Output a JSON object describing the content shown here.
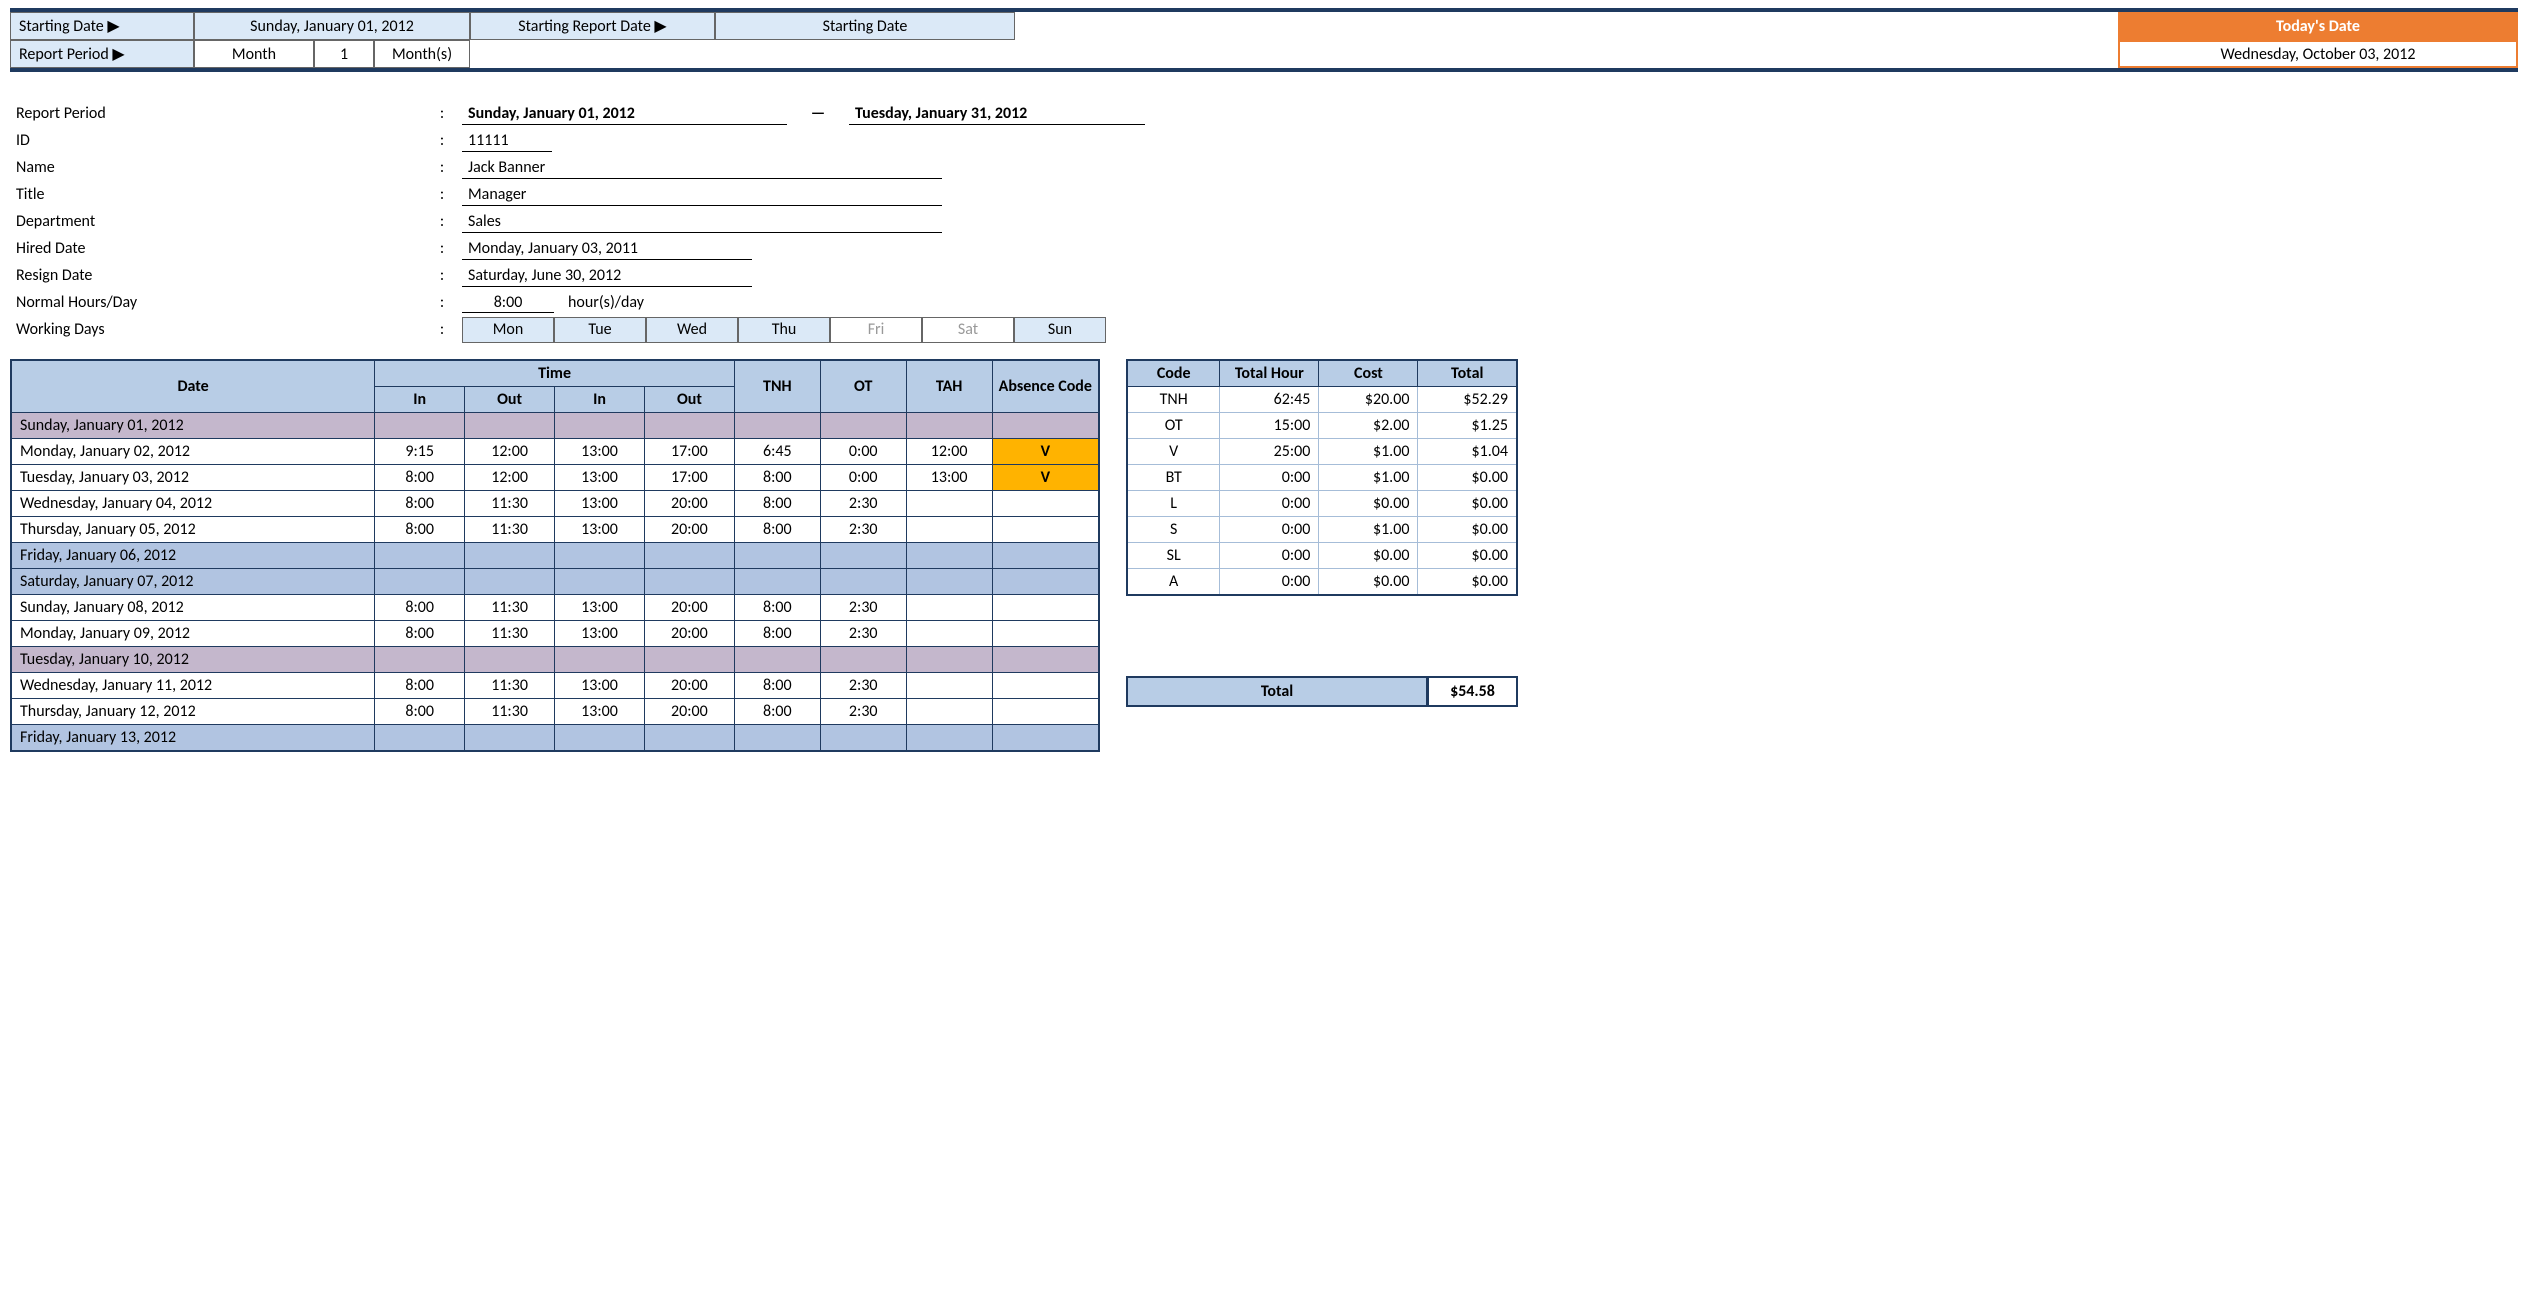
{
  "topbar": {
    "starting_date_label": "Starting Date ▶",
    "starting_date_value": "Sunday, January 01, 2012",
    "report_period_label": "Report Period ▶",
    "report_period_type": "Month",
    "report_period_num": "1",
    "report_period_unit": "Month(s)",
    "starting_report_date_label": "Starting Report Date ▶",
    "starting_report_date_value": "Starting Date",
    "todays_date_label": "Today's Date",
    "todays_date_value": "Wednesday, October 03, 2012"
  },
  "info": {
    "report_period_label": "Report Period",
    "period_from": "Sunday, January 01, 2012",
    "period_to": "Tuesday, January 31, 2012",
    "id_label": "ID",
    "id": "11111",
    "name_label": "Name",
    "name": "Jack Banner",
    "title_label": "Title",
    "title": "Manager",
    "dept_label": "Department",
    "dept": "Sales",
    "hired_label": "Hired Date",
    "hired": "Monday, January 03, 2011",
    "resign_label": "Resign Date",
    "resign": "Saturday, June 30, 2012",
    "hours_label": "Normal Hours/Day",
    "hours_val": "8:00",
    "hours_unit": "hour(s)/day",
    "working_days_label": "Working Days",
    "days": [
      "Mon",
      "Tue",
      "Wed",
      "Thu",
      "Fri",
      "Sat",
      "Sun"
    ],
    "days_active": [
      true,
      true,
      true,
      true,
      false,
      false,
      true
    ]
  },
  "columns": {
    "date": "Date",
    "time": "Time",
    "in": "In",
    "out": "Out",
    "tnh": "TNH",
    "ot": "OT",
    "tah": "TAH",
    "abs": "Absence Code"
  },
  "rows": [
    {
      "date": "Sunday, January 01, 2012",
      "style": "purple",
      "in1": "",
      "out1": "",
      "in2": "",
      "out2": "",
      "tnh": "",
      "ot": "",
      "tah": "",
      "abs": ""
    },
    {
      "date": "Monday, January 02, 2012",
      "style": "white",
      "in1": "9:15",
      "out1": "12:00",
      "in2": "13:00",
      "out2": "17:00",
      "tnh": "6:45",
      "ot": "0:00",
      "tah": "12:00",
      "abs": "V",
      "absHot": true
    },
    {
      "date": "Tuesday, January 03, 2012",
      "style": "white",
      "in1": "8:00",
      "out1": "12:00",
      "in2": "13:00",
      "out2": "17:00",
      "tnh": "8:00",
      "ot": "0:00",
      "tah": "13:00",
      "abs": "V",
      "absHot": true
    },
    {
      "date": "Wednesday, January 04, 2012",
      "style": "white",
      "in1": "8:00",
      "out1": "11:30",
      "in2": "13:00",
      "out2": "20:00",
      "tnh": "8:00",
      "ot": "2:30",
      "tah": "",
      "abs": ""
    },
    {
      "date": "Thursday, January 05, 2012",
      "style": "white",
      "in1": "8:00",
      "out1": "11:30",
      "in2": "13:00",
      "out2": "20:00",
      "tnh": "8:00",
      "ot": "2:30",
      "tah": "",
      "abs": ""
    },
    {
      "date": "Friday, January 06, 2012",
      "style": "blue",
      "in1": "",
      "out1": "",
      "in2": "",
      "out2": "",
      "tnh": "",
      "ot": "",
      "tah": "",
      "abs": ""
    },
    {
      "date": "Saturday, January 07, 2012",
      "style": "blue",
      "in1": "",
      "out1": "",
      "in2": "",
      "out2": "",
      "tnh": "",
      "ot": "",
      "tah": "",
      "abs": ""
    },
    {
      "date": "Sunday, January 08, 2012",
      "style": "white",
      "in1": "8:00",
      "out1": "11:30",
      "in2": "13:00",
      "out2": "20:00",
      "tnh": "8:00",
      "ot": "2:30",
      "tah": "",
      "abs": ""
    },
    {
      "date": "Monday, January 09, 2012",
      "style": "white",
      "in1": "8:00",
      "out1": "11:30",
      "in2": "13:00",
      "out2": "20:00",
      "tnh": "8:00",
      "ot": "2:30",
      "tah": "",
      "abs": ""
    },
    {
      "date": "Tuesday, January 10, 2012",
      "style": "purple",
      "in1": "",
      "out1": "",
      "in2": "",
      "out2": "",
      "tnh": "",
      "ot": "",
      "tah": "",
      "abs": ""
    },
    {
      "date": "Wednesday, January 11, 2012",
      "style": "white",
      "in1": "8:00",
      "out1": "11:30",
      "in2": "13:00",
      "out2": "20:00",
      "tnh": "8:00",
      "ot": "2:30",
      "tah": "",
      "abs": ""
    },
    {
      "date": "Thursday, January 12, 2012",
      "style": "white",
      "in1": "8:00",
      "out1": "11:30",
      "in2": "13:00",
      "out2": "20:00",
      "tnh": "8:00",
      "ot": "2:30",
      "tah": "",
      "abs": ""
    },
    {
      "date": "Friday, January 13, 2012",
      "style": "blue",
      "in1": "",
      "out1": "",
      "in2": "",
      "out2": "",
      "tnh": "",
      "ot": "",
      "tah": "",
      "abs": ""
    }
  ],
  "summary": {
    "headers": {
      "code": "Code",
      "th": "Total Hour",
      "cost": "Cost",
      "total": "Total"
    },
    "rows": [
      {
        "code": "TNH",
        "th": "62:45",
        "cost": "$20.00",
        "total": "$52.29"
      },
      {
        "code": "OT",
        "th": "15:00",
        "cost": "$2.00",
        "total": "$1.25"
      },
      {
        "code": "V",
        "th": "25:00",
        "cost": "$1.00",
        "total": "$1.04"
      },
      {
        "code": "BT",
        "th": "0:00",
        "cost": "$1.00",
        "total": "$0.00"
      },
      {
        "code": "L",
        "th": "0:00",
        "cost": "$0.00",
        "total": "$0.00"
      },
      {
        "code": "S",
        "th": "0:00",
        "cost": "$1.00",
        "total": "$0.00"
      },
      {
        "code": "SL",
        "th": "0:00",
        "cost": "$0.00",
        "total": "$0.00"
      },
      {
        "code": "A",
        "th": "0:00",
        "cost": "$0.00",
        "total": "$0.00"
      }
    ],
    "grand_total_label": "Total",
    "grand_total": "$54.58"
  }
}
